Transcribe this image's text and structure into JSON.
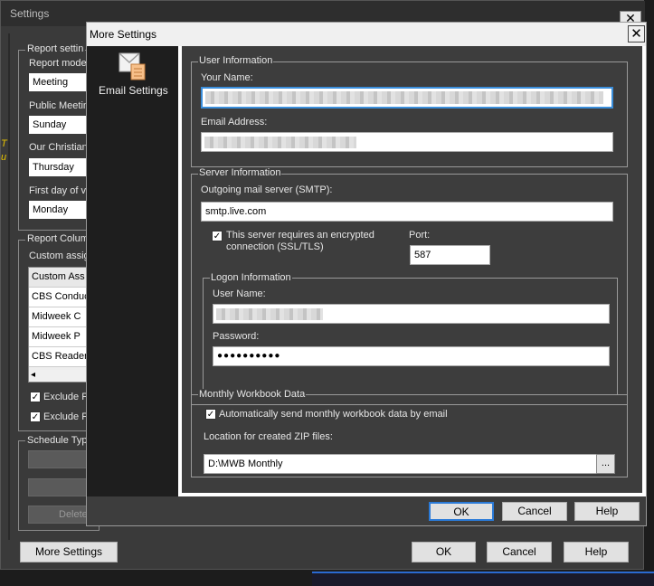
{
  "back": {
    "title": "Settings",
    "close_glyph": "✕",
    "report_settings": {
      "group_label": "Report settin",
      "report_mode_label": "Report mode",
      "report_mode_value": "Meeting",
      "public_meeting_label": "Public Meetin",
      "public_meeting_value": "Sunday",
      "our_christian_label": "Our Christian",
      "our_christian_value": "Thursday",
      "first_day_label": "First day of v",
      "first_day_value": "Monday"
    },
    "report_columns": {
      "group_label": "Report Colum",
      "custom_assign_label": "Custom assig",
      "list_header": "Custom Ass",
      "rows": [
        "CBS Conduc",
        "Midweek C",
        "Midweek P",
        "CBS Reader"
      ],
      "scroll_left_glyph": "◂",
      "exclude_1": "Exclude P",
      "exclude_2": "Exclude P",
      "check_glyph": "✓"
    },
    "schedule": {
      "group_label": "Schedule Typ",
      "delete_label": "Delete"
    },
    "side_warning_1": "T",
    "side_warning_2": "u",
    "buttons": {
      "more_settings": "More Settings",
      "ok": "OK",
      "cancel": "Cancel",
      "help": "Help"
    }
  },
  "dialog": {
    "title": "More Settings",
    "close_glyph": "✕",
    "sidebar": {
      "item_label": "Email Settings",
      "item_icon": "email-settings-icon"
    },
    "user_info": {
      "group_label": "User Information",
      "your_name_label": "Your Name:",
      "your_name_value": "",
      "email_label": "Email Address:",
      "email_value": ""
    },
    "server_info": {
      "group_label": "Server Information",
      "smtp_label": "Outgoing mail server (SMTP):",
      "smtp_value": "smtp.live.com",
      "encrypted_label_1": "This server requires an encrypted",
      "encrypted_label_2": "connection (SSL/TLS)",
      "encrypted_checked": true,
      "port_label": "Port:",
      "port_value": "587",
      "logon": {
        "group_label": "Logon Information",
        "user_name_label": "User Name:",
        "user_name_value": "",
        "password_label": "Password:",
        "password_value": "●●●●●●●●●●"
      }
    },
    "workbook": {
      "group_label": "Monthly Workbook Data",
      "auto_send_label": "Automatically send monthly workbook data by email",
      "auto_send_checked": true,
      "zip_location_label": "Location for created ZIP files:",
      "zip_location_value": "D:\\MWB Monthly",
      "browse_label": "..."
    },
    "buttons": {
      "ok": "OK",
      "cancel": "Cancel",
      "help": "Help"
    }
  }
}
